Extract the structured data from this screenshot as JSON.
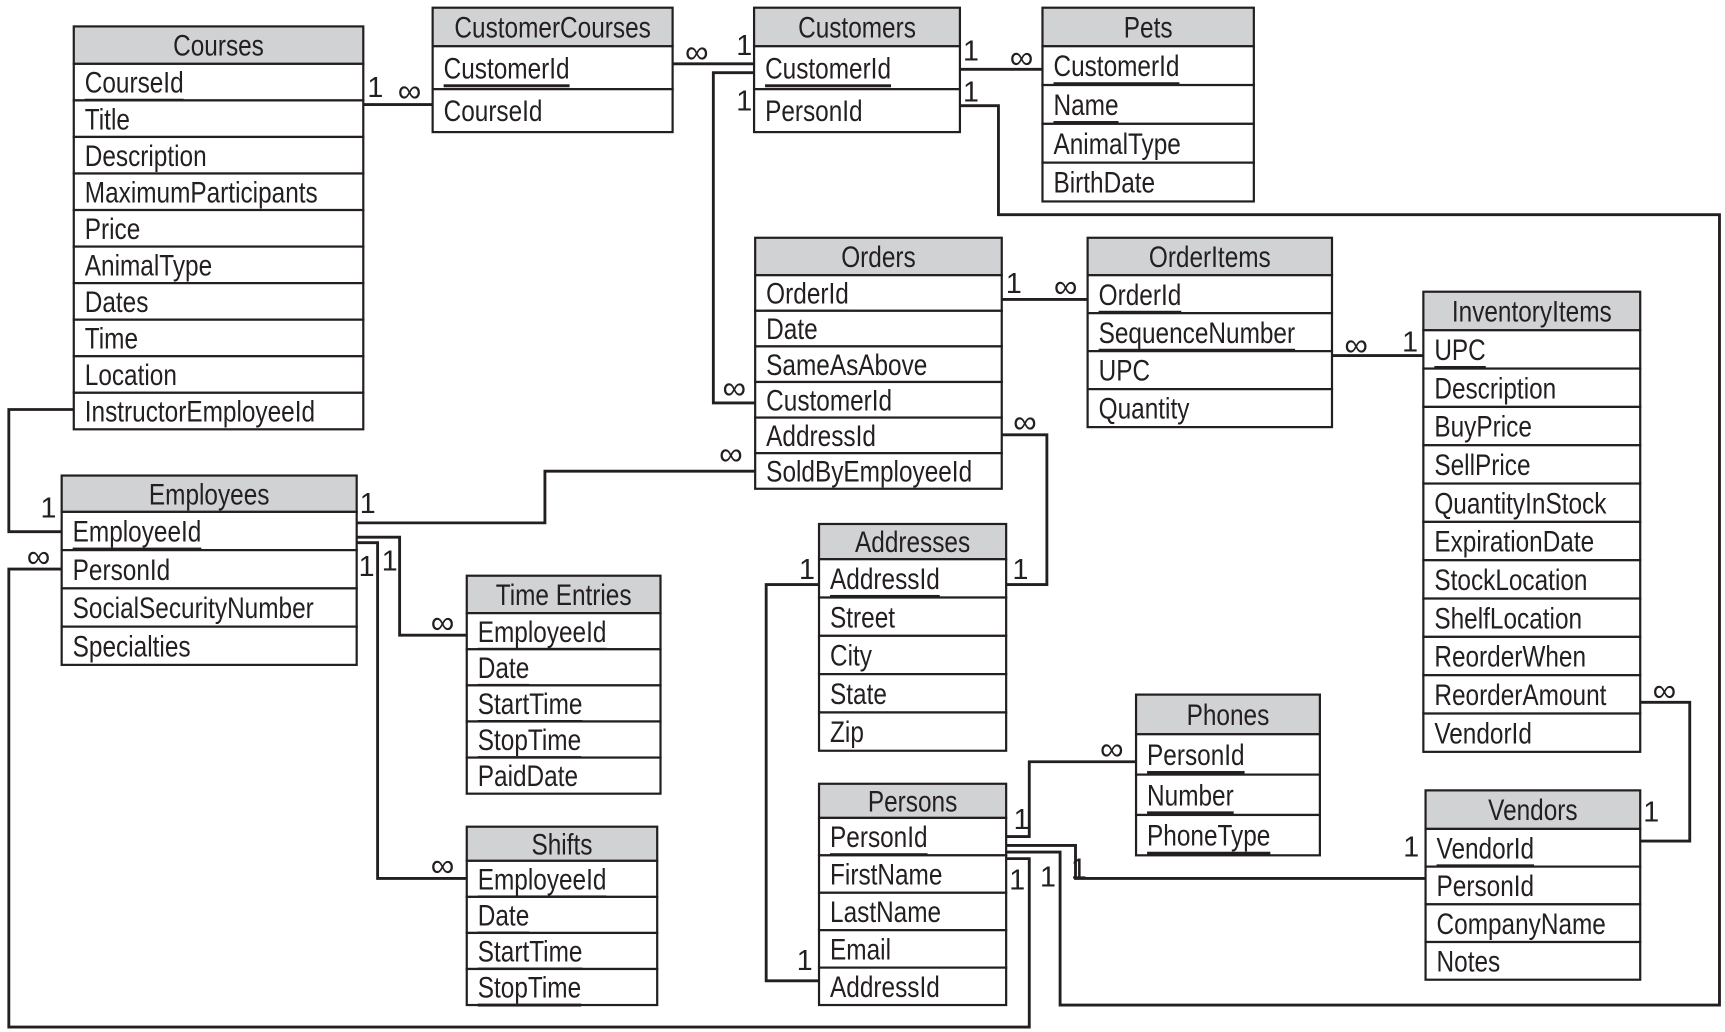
{
  "diagram": {
    "colors": {
      "header_fill": "#d1d2d4",
      "line": "#231f20",
      "background": "#ffffff"
    },
    "tables": [
      {
        "name": "Courses",
        "fields": [
          {
            "name": "CourseId",
            "pk": true
          },
          {
            "name": "Title"
          },
          {
            "name": "Description"
          },
          {
            "name": "MaximumParticipants"
          },
          {
            "name": "Price"
          },
          {
            "name": "AnimalType"
          },
          {
            "name": "Dates"
          },
          {
            "name": "Time"
          },
          {
            "name": "Location"
          },
          {
            "name": "InstructorEmployeeId"
          }
        ]
      },
      {
        "name": "CustomerCourses",
        "fields": [
          {
            "name": "CustomerId",
            "pk": true
          },
          {
            "name": "CourseId"
          }
        ]
      },
      {
        "name": "Customers",
        "fields": [
          {
            "name": "CustomerId",
            "pk": true
          },
          {
            "name": "PersonId"
          }
        ]
      },
      {
        "name": "Pets",
        "fields": [
          {
            "name": "CustomerId",
            "pk": true
          },
          {
            "name": "Name",
            "pk": true
          },
          {
            "name": "AnimalType"
          },
          {
            "name": "BirthDate"
          }
        ]
      },
      {
        "name": "Orders",
        "fields": [
          {
            "name": "OrderId",
            "pk": true
          },
          {
            "name": "Date"
          },
          {
            "name": "SameAsAbove"
          },
          {
            "name": "CustomerId"
          },
          {
            "name": "AddressId"
          },
          {
            "name": "SoldByEmployeeId"
          }
        ]
      },
      {
        "name": "OrderItems",
        "fields": [
          {
            "name": "OrderId",
            "pk": true
          },
          {
            "name": "SequenceNumber",
            "pk": true
          },
          {
            "name": "UPC"
          },
          {
            "name": "Quantity"
          }
        ]
      },
      {
        "name": "InventoryItems",
        "fields": [
          {
            "name": "UPC",
            "pk": true
          },
          {
            "name": "Description"
          },
          {
            "name": "BuyPrice"
          },
          {
            "name": "SellPrice"
          },
          {
            "name": "QuantityInStock"
          },
          {
            "name": "ExpirationDate"
          },
          {
            "name": "StockLocation"
          },
          {
            "name": "ShelfLocation"
          },
          {
            "name": "ReorderWhen"
          },
          {
            "name": "ReorderAmount"
          },
          {
            "name": "VendorId"
          }
        ]
      },
      {
        "name": "Employees",
        "fields": [
          {
            "name": "EmployeeId",
            "pk": true
          },
          {
            "name": "PersonId"
          },
          {
            "name": "SocialSecurityNumber"
          },
          {
            "name": "Specialties"
          }
        ]
      },
      {
        "name": "Time Entries",
        "fields": [
          {
            "name": "EmployeeId",
            "pk": true
          },
          {
            "name": "Date",
            "pk": true
          },
          {
            "name": "StartTime",
            "pk": true
          },
          {
            "name": "StopTime",
            "pk": true
          },
          {
            "name": "PaidDate"
          }
        ]
      },
      {
        "name": "Shifts",
        "fields": [
          {
            "name": "EmployeeId",
            "pk": true
          },
          {
            "name": "Date",
            "pk": true
          },
          {
            "name": "StartTime",
            "pk": true
          },
          {
            "name": "StopTime",
            "pk": true
          }
        ]
      },
      {
        "name": "Addresses",
        "fields": [
          {
            "name": "AddressId",
            "pk": true
          },
          {
            "name": "Street"
          },
          {
            "name": "City"
          },
          {
            "name": "State"
          },
          {
            "name": "Zip"
          }
        ]
      },
      {
        "name": "Persons",
        "fields": [
          {
            "name": "PersonId",
            "pk": true
          },
          {
            "name": "FirstName"
          },
          {
            "name": "LastName"
          },
          {
            "name": "Email"
          },
          {
            "name": "AddressId"
          }
        ]
      },
      {
        "name": "Phones",
        "fields": [
          {
            "name": "PersonId",
            "pk": true
          },
          {
            "name": "Number",
            "pk": true
          },
          {
            "name": "PhoneType",
            "pk": true
          }
        ]
      },
      {
        "name": "Vendors",
        "fields": [
          {
            "name": "VendorId",
            "pk": true
          },
          {
            "name": "PersonId"
          },
          {
            "name": "CompanyName"
          },
          {
            "name": "Notes"
          }
        ]
      }
    ],
    "relationships": [
      {
        "from": "Courses.CourseId",
        "to": "CustomerCourses.CourseId",
        "from_card": "1",
        "to_card": "∞"
      },
      {
        "from": "CustomerCourses.CustomerId",
        "to": "Customers.CustomerId",
        "from_card": "∞",
        "to_card": "1"
      },
      {
        "from": "Customers.CustomerId",
        "to": "Orders.CustomerId",
        "from_card": "1",
        "to_card": "∞"
      },
      {
        "from": "Customers.CustomerId",
        "to": "Pets.CustomerId",
        "from_card": "1",
        "to_card": "∞"
      },
      {
        "from": "Customers.PersonId",
        "to": "Persons.PersonId",
        "from_card": "1",
        "to_card": "1"
      },
      {
        "from": "Orders.OrderId",
        "to": "OrderItems.OrderId",
        "from_card": "1",
        "to_card": "∞"
      },
      {
        "from": "OrderItems.UPC",
        "to": "InventoryItems.UPC",
        "from_card": "∞",
        "to_card": "1"
      },
      {
        "from": "Orders.AddressId",
        "to": "Addresses.AddressId",
        "from_card": "∞",
        "to_card": "1"
      },
      {
        "from": "Orders.SoldByEmployeeId",
        "to": "Employees.EmployeeId",
        "from_card": "∞",
        "to_card": "1"
      },
      {
        "from": "Courses.InstructorEmployeeId",
        "to": "Employees.EmployeeId",
        "to_card": "1"
      },
      {
        "from": "Employees.EmployeeId",
        "to": "Time Entries.EmployeeId",
        "from_card": "1",
        "to_card": "∞"
      },
      {
        "from": "Employees.EmployeeId",
        "to": "Shifts.EmployeeId",
        "from_card": "1",
        "to_card": "∞"
      },
      {
        "from": "Addresses.AddressId",
        "to": "Persons.AddressId",
        "from_card": "1",
        "to_card": "1"
      },
      {
        "from": "InventoryItems.VendorId",
        "to": "Vendors.VendorId",
        "from_card": "∞",
        "to_card": "1"
      },
      {
        "from": "Persons.PersonId",
        "to": "Phones.PersonId",
        "from_card": "1",
        "to_card": "∞"
      },
      {
        "from": "Persons.PersonId",
        "to": "Vendors.PersonId",
        "from_card": "1",
        "to_card": "1"
      },
      {
        "from": "Persons.PersonId",
        "to": "Employees.PersonId",
        "from_card": "1",
        "to_card": "∞"
      }
    ]
  }
}
